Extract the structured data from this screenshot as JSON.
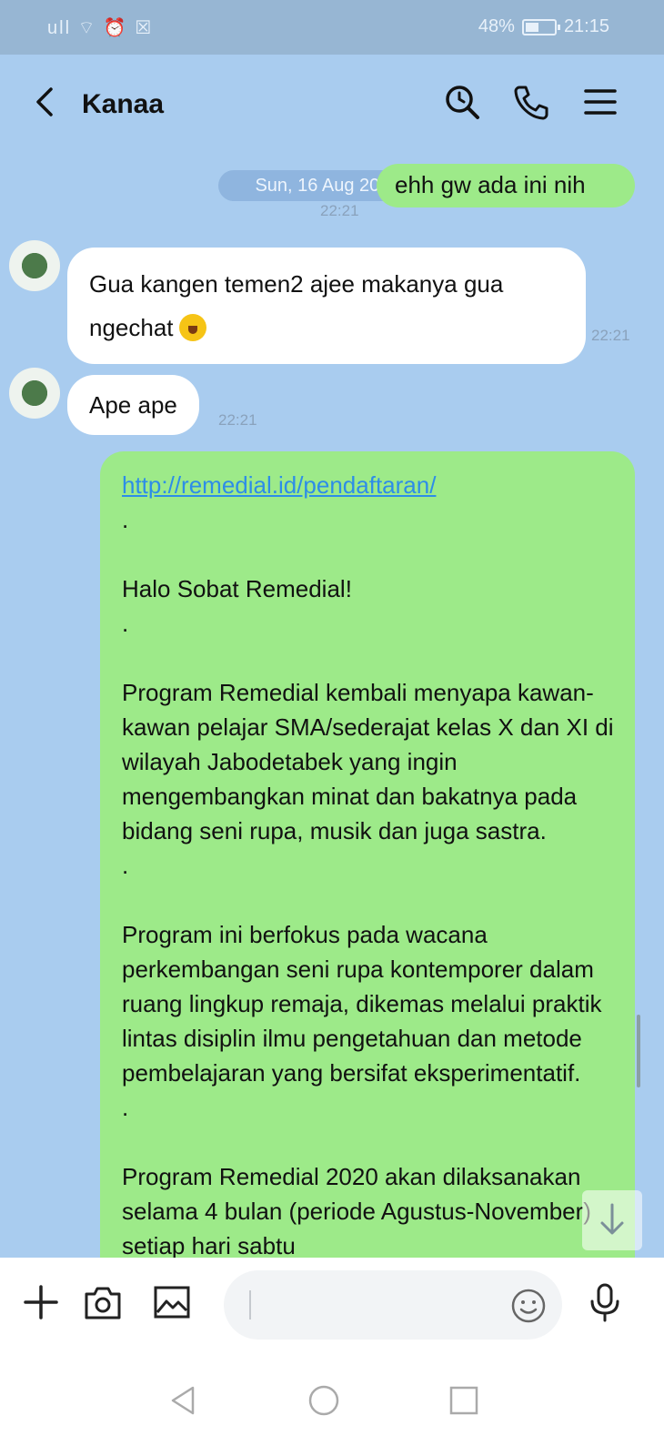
{
  "status_bar": {
    "signal_icons": "ull ⌔ ⏰ ☒",
    "battery_percent": "48%",
    "battery_level": 0.48,
    "time": "21:15"
  },
  "header": {
    "contact_name": "Kanaa",
    "icons": [
      "back-chevron-icon",
      "search-icon",
      "phone-icon",
      "menu-icon"
    ]
  },
  "date_divider": "Sun, 16 Aug 2020",
  "messages": [
    {
      "direction": "out",
      "text": "ehh gw ada ini nih",
      "time": "22:21"
    },
    {
      "direction": "in",
      "text": "Gua kangen temen2 ajee makanya gua ngechat",
      "emoji": "grinning-face-emoji",
      "time": "22:21"
    },
    {
      "direction": "in",
      "text": "Ape ape",
      "time": "22:21"
    },
    {
      "direction": "out",
      "link": "http://remedial.id/pendaftaran/",
      "paragraphs": [
        ".",
        "Halo Sobat Remedial!",
        ".",
        "Program Remedial kembali menyapa kawan-kawan pelajar SMA/sederajat kelas X dan XI di wilayah Jabodetabek yang ingin mengembangkan minat dan bakatnya pada bidang seni rupa, musik dan juga sastra.",
        ".",
        "Program ini berfokus pada wacana perkembangan seni rupa kontemporer dalam ruang lingkup remaja, dikemas melalui praktik lintas disiplin ilmu pengetahuan dan metode pembelajaran yang bersifat eksperimentatif.",
        ".",
        "Program Remedial 2020 akan dilaksanakan selama 4 bulan (periode Agustus-November) setiap hari sabtu"
      ]
    }
  ],
  "composer": {
    "placeholder": "",
    "icons": [
      "plus-icon",
      "camera-icon",
      "image-icon",
      "emoji-icon",
      "microphone-icon"
    ]
  },
  "nav_bar": [
    "back-triangle-icon",
    "home-circle-icon",
    "recents-square-icon"
  ],
  "colors": {
    "background": "#a9ccef",
    "outgoing_bubble": "#9dea89",
    "incoming_bubble": "#ffffff",
    "link": "#2d8de8"
  }
}
